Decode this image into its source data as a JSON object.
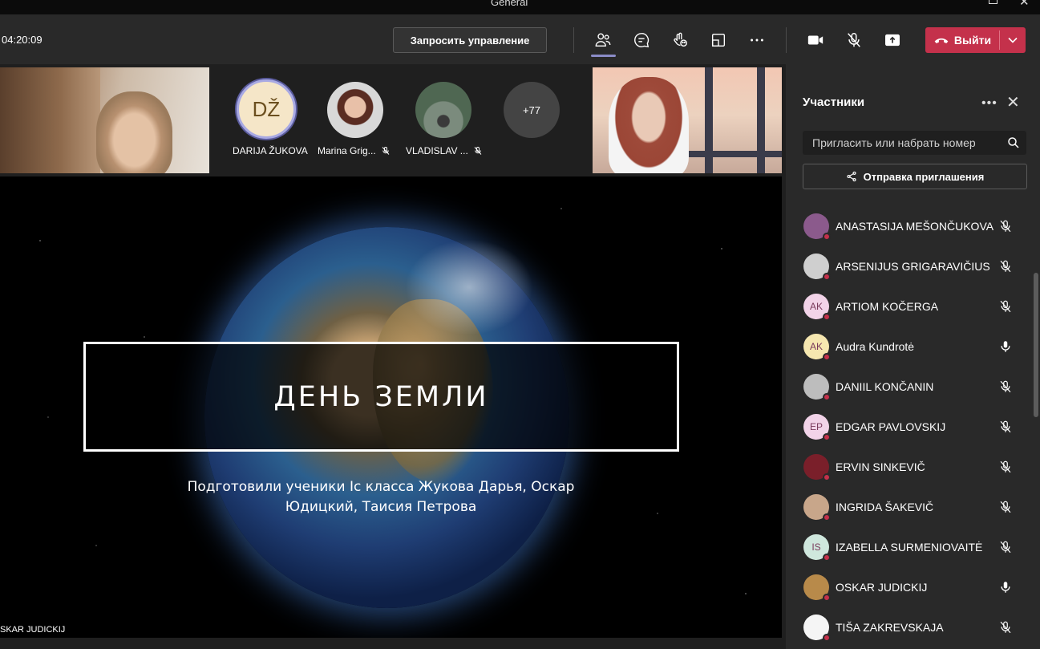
{
  "window": {
    "title": "General"
  },
  "toolbar": {
    "timer": "04:20:09",
    "request_control_label": "Запросить управление",
    "leave_label": "Выйти",
    "icons": [
      "people-icon",
      "chat-icon",
      "reactions-icon",
      "rooms-icon",
      "more-icon",
      "camera-icon",
      "mic-off-icon",
      "share-icon"
    ]
  },
  "strip": {
    "tiles": [
      {
        "initials": "DŽ",
        "name": "DARIJA ŽUKOVA"
      },
      {
        "name": "Marina Grig...",
        "muted": true
      },
      {
        "name": "VLADISLAV ...",
        "muted": true
      }
    ],
    "more_count": "+77"
  },
  "stage": {
    "slide_title": "ДЕНЬ ЗЕМЛИ",
    "slide_subtitle": "Подготовили ученики Ic класса Жукова Дарья, Оскар Юдицкий, Таисия Петрова",
    "presenter_label": "SKAR JUDICKIJ"
  },
  "panel": {
    "title": "Участники",
    "invite_placeholder": "Пригласить или набрать номер",
    "share_invite_label": "Отправка приглашения",
    "participants": [
      {
        "name": "ANASTASIJA MEŠONČUKOVA",
        "initials": "",
        "avatar_color": "#8b5a8c",
        "mic": "off"
      },
      {
        "name": "ARSENIJUS GRIGARAVIČIUS",
        "initials": "",
        "avatar_color": "#cfcfcf",
        "mic": "off"
      },
      {
        "name": "ARTIOM KOČERGA",
        "initials": "AK",
        "avatar_color": "#f2d3e8",
        "mic": "off"
      },
      {
        "name": "Audra Kundrotė",
        "initials": "AK",
        "avatar_color": "#f6e7b0",
        "mic": "on"
      },
      {
        "name": "DANIIL KONČANIN",
        "initials": "",
        "avatar_color": "#bdbdbd",
        "mic": "off"
      },
      {
        "name": "EDGAR PAVLOVSKIJ",
        "initials": "EP",
        "avatar_color": "#f2d3e8",
        "mic": "off"
      },
      {
        "name": "ERVIN SINKEVIČ",
        "initials": "",
        "avatar_color": "#7a1f2a",
        "mic": "off"
      },
      {
        "name": "INGRIDA ŠAKEVIČ",
        "initials": "",
        "avatar_color": "#c8a68a",
        "mic": "off"
      },
      {
        "name": "IZABELLA SURMENIOVAITĖ",
        "initials": "IS",
        "avatar_color": "#cfe7dd",
        "mic": "off"
      },
      {
        "name": "OSKAR JUDICKIJ",
        "initials": "",
        "avatar_color": "#b88a4a",
        "mic": "on"
      },
      {
        "name": "TIŠA ZAKREVSKAJA",
        "initials": "",
        "avatar_color": "#f5f5f5",
        "mic": "off"
      }
    ]
  },
  "colors": {
    "leave": "#c4314b",
    "accent": "#8b8cc7",
    "panel_bg": "#292929"
  }
}
